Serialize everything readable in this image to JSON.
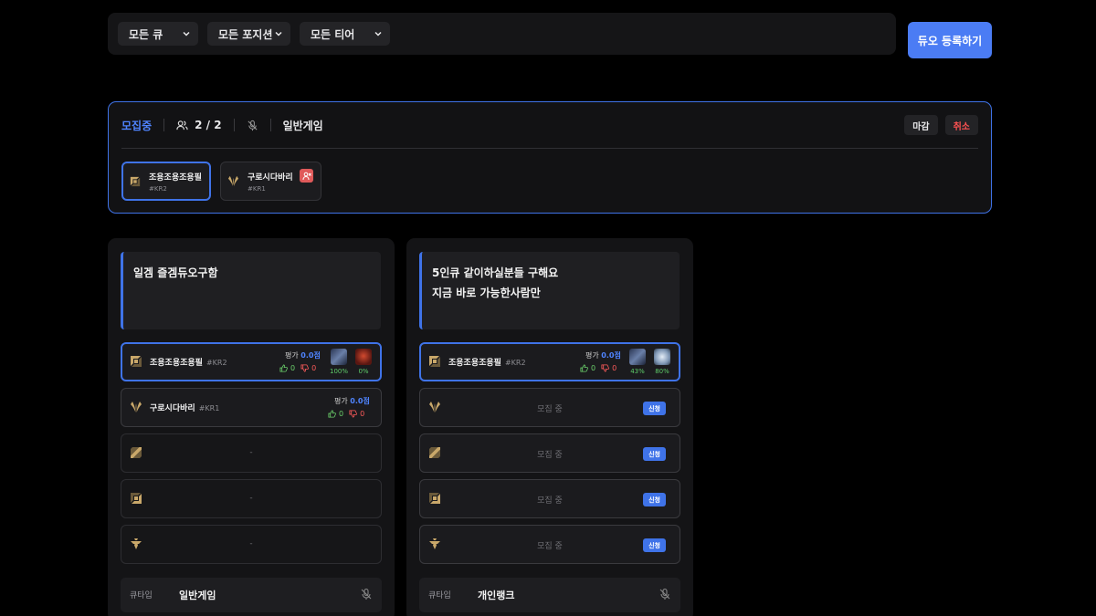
{
  "filters": {
    "queue": "모든 큐",
    "position": "모든 포지션",
    "tier": "모든 티어"
  },
  "register_button": "듀오 등록하기",
  "active_post": {
    "status": "모집중",
    "count": "2 / 2",
    "queue": "일반게임",
    "close_button": "마감",
    "cancel_button": "취소",
    "members": [
      {
        "name": "조용조용조용필",
        "tag": "#KR2",
        "position": "top",
        "highlighted": true
      },
      {
        "name": "구로시다바리",
        "tag": "#KR1",
        "position": "jungle",
        "highlighted": false
      }
    ]
  },
  "posts": [
    {
      "description": [
        "일겜 즐겜듀오구함"
      ],
      "slots": [
        {
          "type": "filled",
          "position": "top",
          "name": "조용조용조용필",
          "tag": "#KR2",
          "rating_label": "평가",
          "rating": "0.0점",
          "likes": "0",
          "dislikes": "0",
          "champions": [
            {
              "color": "#3b4a6b",
              "pct": "100%"
            },
            {
              "color": "#7a2a22",
              "pct": "0%"
            }
          ],
          "mine": true
        },
        {
          "type": "filled",
          "position": "jungle",
          "name": "구로시다바리",
          "tag": "#KR1",
          "rating_label": "평가",
          "rating": "0.0점",
          "likes": "0",
          "dislikes": "0",
          "champions": [],
          "mine": false
        },
        {
          "type": "empty",
          "position": "mid",
          "text": "-"
        },
        {
          "type": "empty",
          "position": "bottom",
          "text": "-"
        },
        {
          "type": "empty",
          "position": "support",
          "text": "-"
        }
      ],
      "queue_label": "큐타입",
      "queue_value": "일반게임"
    },
    {
      "description": [
        "5인큐 같이하실분들 구해요",
        "지금 바로 가능한사람만"
      ],
      "slots": [
        {
          "type": "filled",
          "position": "top",
          "name": "조용조용조용필",
          "tag": "#KR2",
          "rating_label": "평가",
          "rating": "0.0점",
          "likes": "0",
          "dislikes": "0",
          "champions": [
            {
              "color": "#3b4a6b",
              "pct": "43%"
            },
            {
              "color": "#7f97b5",
              "pct": "80%"
            }
          ],
          "mine": true
        },
        {
          "type": "open",
          "position": "jungle",
          "text": "모집 중",
          "apply": "신청"
        },
        {
          "type": "open",
          "position": "mid",
          "text": "모집 중",
          "apply": "신청"
        },
        {
          "type": "open",
          "position": "bottom",
          "text": "모집 중",
          "apply": "신청"
        },
        {
          "type": "open",
          "position": "support",
          "text": "모집 중",
          "apply": "신청"
        }
      ],
      "queue_label": "큐타입",
      "queue_value": "개인랭크"
    }
  ],
  "colors": {
    "accent": "#3f73e8",
    "like": "#6bd06b",
    "dislike": "#ff5b5b",
    "position_icon": "#c9a86a"
  }
}
